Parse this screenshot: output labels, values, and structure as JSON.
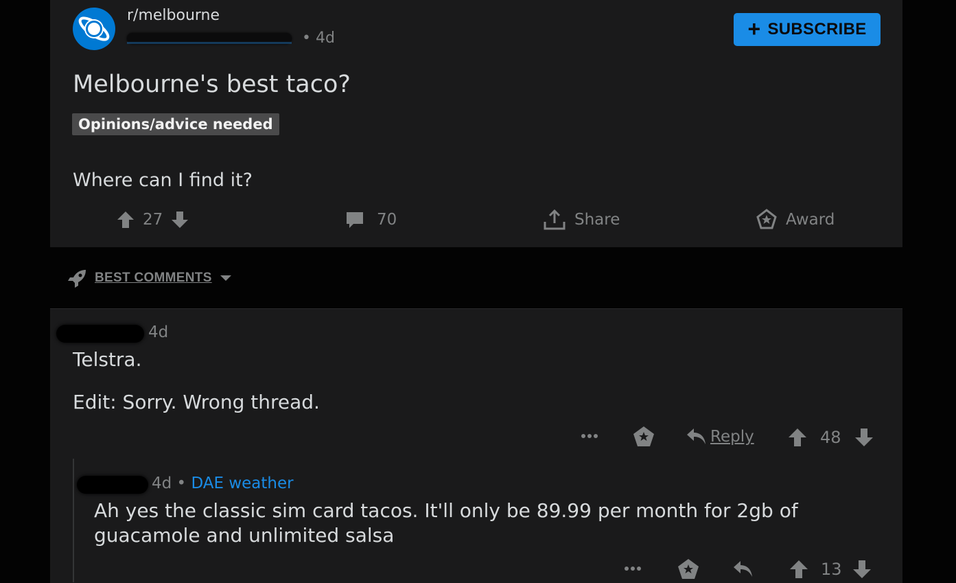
{
  "post": {
    "subreddit": "r/melbourne",
    "age": "4d",
    "subscribe_label": "SUBSCRIBE",
    "title": "Melbourne's best taco?",
    "flair": "Opinions/advice needed",
    "body": "Where can I find it?",
    "score": "27",
    "comments": "70",
    "share_label": "Share",
    "award_label": "Award"
  },
  "sort": {
    "label": "BEST COMMENTS"
  },
  "comments": [
    {
      "age": "4d",
      "lines": [
        "Telstra.",
        "Edit: Sorry. Wrong thread."
      ],
      "reply_label": "Reply",
      "score": "48"
    },
    {
      "age": "4d",
      "separator": "•",
      "user_flair": "DAE weather",
      "lines": [
        "Ah yes the classic sim card tacos. It'll only be 89.99 per month for 2gb of",
        "guacamole and unlimited salsa"
      ],
      "score": "13"
    }
  ],
  "colors": {
    "page_bg": "#030303",
    "card_bg": "#1a1a1b",
    "accent": "#1a8ce6",
    "muted": "#818384",
    "text": "#d7dadc"
  },
  "icons": [
    "reddit-planet-icon",
    "upvote-icon",
    "downvote-icon",
    "comment-icon",
    "share-icon",
    "award-icon",
    "rocket-icon",
    "caret-down-icon",
    "more-dots-icon",
    "reply-arrow-icon"
  ]
}
